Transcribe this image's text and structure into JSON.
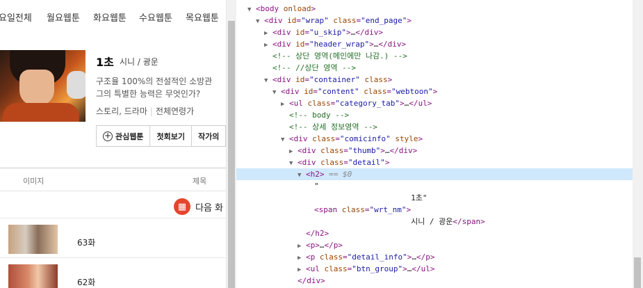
{
  "webtoon": {
    "day_tabs": [
      "요일전체",
      "월요웹툰",
      "화요웹툰",
      "수요웹툰",
      "목요웹툰"
    ],
    "title": "1초",
    "author": "시니 / 광운",
    "description": [
      "구조율 100%의 전설적인 소방관",
      "그의 특별한 능력은 무엇인가?"
    ],
    "genre": "스토리, 드라마",
    "age": "전체연령가",
    "buttons": {
      "favorite": "관심웹툰",
      "first_view": "첫회보기",
      "author_other": "작가의"
    },
    "table_headers": {
      "image": "이미지",
      "title": "제목"
    },
    "next_episode": "다음 화",
    "episodes": [
      {
        "title": "63화"
      },
      {
        "title": "62화"
      }
    ]
  },
  "devtools": {
    "nodes": [
      {
        "indent": 0,
        "tri": "▼",
        "type": "el",
        "tag": "body",
        "attrs": [
          {
            "n": "onload",
            "v": null
          }
        ],
        "close": false
      },
      {
        "indent": 1,
        "tri": "▼",
        "type": "el",
        "tag": "div",
        "attrs": [
          {
            "n": "id",
            "v": "\"wrap\""
          },
          {
            "n": "class",
            "v": "\"end_page\""
          }
        ],
        "close": false
      },
      {
        "indent": 2,
        "tri": "▶",
        "type": "el",
        "tag": "div",
        "attrs": [
          {
            "n": "id",
            "v": "\"u_skip\""
          }
        ],
        "close": true
      },
      {
        "indent": 2,
        "tri": "▶",
        "type": "el",
        "tag": "div",
        "attrs": [
          {
            "n": "id",
            "v": "\"header_wrap\""
          }
        ],
        "close": true
      },
      {
        "indent": 2,
        "tri": "",
        "type": "comment",
        "text": "<!-- 상단 영역(메인에만 나감.) -->"
      },
      {
        "indent": 2,
        "tri": "",
        "type": "comment",
        "text": "<!-- //상단 영역 -->"
      },
      {
        "indent": 2,
        "tri": "▼",
        "type": "el",
        "tag": "div",
        "attrs": [
          {
            "n": "id",
            "v": "\"container\""
          },
          {
            "n": "class",
            "v": null
          }
        ],
        "close": false
      },
      {
        "indent": 3,
        "tri": "▼",
        "type": "el",
        "tag": "div",
        "attrs": [
          {
            "n": "id",
            "v": "\"content\""
          },
          {
            "n": "class",
            "v": "\"webtoon\""
          }
        ],
        "close": false
      },
      {
        "indent": 4,
        "tri": "▶",
        "type": "el",
        "tag": "ul",
        "attrs": [
          {
            "n": "class",
            "v": "\"category_tab\""
          }
        ],
        "close": true
      },
      {
        "indent": 4,
        "tri": "",
        "type": "comment",
        "text": "<!-- body -->"
      },
      {
        "indent": 4,
        "tri": "",
        "type": "comment",
        "text": "<!-- 상세 정보영역 -->"
      },
      {
        "indent": 4,
        "tri": "▼",
        "type": "el",
        "tag": "div",
        "attrs": [
          {
            "n": "class",
            "v": "\"comicinfo\""
          },
          {
            "n": "style",
            "v": null
          }
        ],
        "close": false
      },
      {
        "indent": 5,
        "tri": "▶",
        "type": "el",
        "tag": "div",
        "attrs": [
          {
            "n": "class",
            "v": "\"thumb\""
          }
        ],
        "close": true
      },
      {
        "indent": 5,
        "tri": "▼",
        "type": "el",
        "tag": "div",
        "attrs": [
          {
            "n": "class",
            "v": "\"detail\""
          }
        ],
        "close": false
      },
      {
        "indent": 6,
        "tri": "▼",
        "type": "el",
        "tag": "h2",
        "attrs": [],
        "close": false,
        "selected": true,
        "suffix": "== $0"
      },
      {
        "indent": 7,
        "tri": "",
        "type": "text",
        "text": "\""
      },
      {
        "indent": 7,
        "tri": "",
        "type": "text",
        "text": "                     1초\""
      },
      {
        "indent": 7,
        "tri": "",
        "type": "el",
        "tag": "span",
        "attrs": [
          {
            "n": "class",
            "v": "\"wrt_nm\""
          }
        ],
        "close": false,
        "inline_text": "",
        "end": false
      },
      {
        "indent": 7,
        "tri": "",
        "type": "spantext",
        "text": "                     시니 / 광운",
        "endtag": "span"
      },
      {
        "indent": 6,
        "tri": "",
        "type": "endtag",
        "tag": "h2"
      },
      {
        "indent": 6,
        "tri": "▶",
        "type": "el",
        "tag": "p",
        "attrs": [],
        "close": true
      },
      {
        "indent": 6,
        "tri": "▶",
        "type": "el",
        "tag": "p",
        "attrs": [
          {
            "n": "class",
            "v": "\"detail_info\""
          }
        ],
        "close": true
      },
      {
        "indent": 6,
        "tri": "▶",
        "type": "el",
        "tag": "ul",
        "attrs": [
          {
            "n": "class",
            "v": "\"btn_group\""
          }
        ],
        "close": true
      },
      {
        "indent": 5,
        "tri": "",
        "type": "endtag",
        "tag": "div"
      }
    ]
  }
}
